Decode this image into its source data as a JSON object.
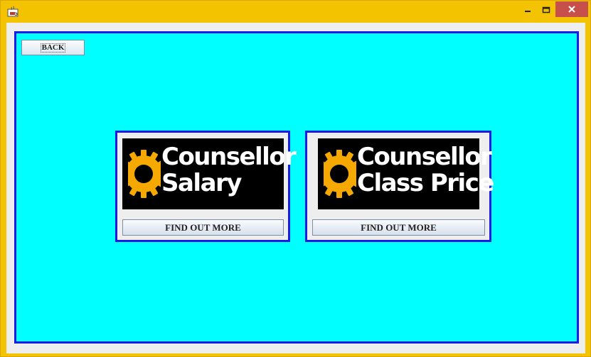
{
  "window": {
    "app_icon": "java-coffee-cup-icon",
    "controls": {
      "minimize": "minimize-icon",
      "maximize": "maximize-icon",
      "close": "close-icon"
    }
  },
  "toolbar": {
    "back_label": "BACK"
  },
  "cards": [
    {
      "banner_line1": "Counsellor",
      "banner_line2": "Salary",
      "button_label": "FIND OUT MORE"
    },
    {
      "banner_line1": "Counsellor",
      "banner_line2": "Class Price",
      "button_label": "FIND OUT MORE"
    }
  ],
  "colors": {
    "titlebar": "#f3c200",
    "panel_background": "#00ffff",
    "panel_border": "#1a1ae6",
    "banner_background": "#000000",
    "gear": "#f5a800",
    "close_button": "#c7504a"
  }
}
